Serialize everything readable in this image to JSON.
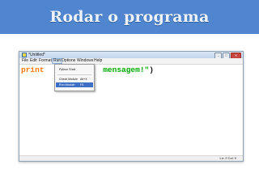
{
  "slide": {
    "title": "Rodar o programa"
  },
  "window": {
    "title": "*Untitled*",
    "icon": "python-idle-icon",
    "controls": {
      "minimize": "–",
      "maximize": "□",
      "close": "✕"
    }
  },
  "menu": {
    "items": [
      {
        "label": "File"
      },
      {
        "label": "Edit"
      },
      {
        "label": "Format"
      },
      {
        "label": "Run"
      },
      {
        "label": "Options"
      },
      {
        "label": "Windows"
      },
      {
        "label": "Help"
      }
    ]
  },
  "run_menu": {
    "items": [
      {
        "label": "Python Shell",
        "shortcut": ""
      },
      {
        "label": "Check Module",
        "shortcut": "Alt+X"
      },
      {
        "label": "Run Module",
        "shortcut": "F5"
      }
    ]
  },
  "editor": {
    "keyword": "print",
    "string": " mensagem!\"",
    "closing": ")"
  },
  "status": {
    "position": "Ln: 2 Col: 0"
  },
  "colors": {
    "banner": "#4f86cf",
    "keyword": "#ff7700",
    "string": "#00aa00",
    "highlight": "#3d6fc4"
  }
}
